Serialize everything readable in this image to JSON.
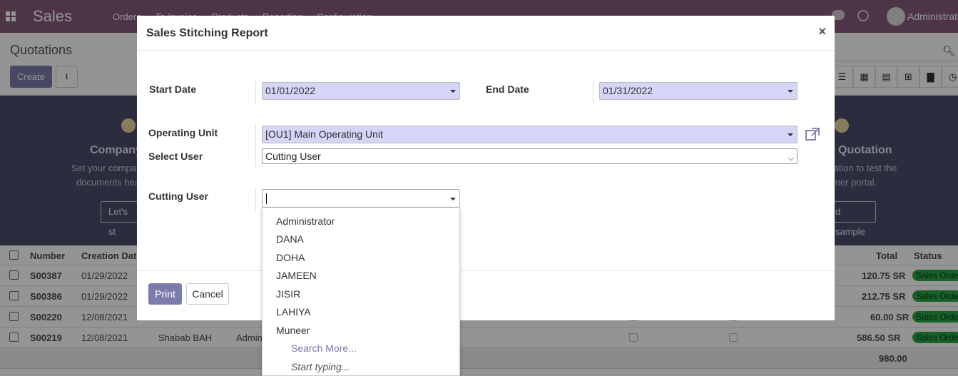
{
  "navbar": {
    "brand": "Sales",
    "menu": [
      "Orders",
      "To Invoice",
      "Products",
      "Reporting",
      "Configuration"
    ],
    "user": "Administrator"
  },
  "control_panel": {
    "title": "Quotations",
    "create_label": "Create"
  },
  "helper": {
    "left_heading": "Company",
    "left_text_1": "Set your compa",
    "left_text_2": "documents hea",
    "left_button": "Let's st",
    "right_heading": "Quotation",
    "right_text_1": "tation to test the",
    "right_text_2": "mer portal.",
    "right_button": "d sample"
  },
  "table": {
    "headers": {
      "number": "Number",
      "creation_date": "Creation Dat",
      "total": "Total",
      "status": "Status"
    },
    "rows": [
      {
        "number": "S00387",
        "date": "01/29/2022",
        "customer": "",
        "salesperson": "",
        "total": "120.75 SR",
        "status": "Sales Orde"
      },
      {
        "number": "S00386",
        "date": "01/29/2022",
        "customer": "",
        "salesperson": "",
        "total": "212.75 SR",
        "status": "Sales Orde"
      },
      {
        "number": "S00220",
        "date": "12/08/2021",
        "customer": "Shabab BAH",
        "salesperson": "Admin",
        "total": "60.00 SR",
        "status": "Sales Orde"
      },
      {
        "number": "S00219",
        "date": "12/08/2021",
        "customer": "Shabab BAH",
        "salesperson": "Admin",
        "total": "586.50 SR",
        "status": "Sales Orde"
      }
    ],
    "sum": "980.00"
  },
  "dialog": {
    "title": "Sales Stitching Report",
    "start_date_label": "Start Date",
    "start_date_value": "01/01/2022",
    "end_date_label": "End Date",
    "end_date_value": "01/31/2022",
    "operating_unit_label": "Operating Unit",
    "operating_unit_value": "[OU1] Main Operating Unit",
    "select_user_label": "Select User",
    "select_user_value": "Cutting User",
    "cutting_user_label": "Cutting User",
    "cutting_user_value": "",
    "print_label": "Print",
    "cancel_label": "Cancel"
  },
  "dropdown": {
    "items": [
      "Administrator",
      "DANA",
      "DOHA",
      "JAMEEN",
      "JISIR",
      "LAHIYA",
      "Muneer"
    ],
    "search_more": "Search More...",
    "start_typing": "Start typing..."
  },
  "colors": {
    "brand": "#875A7B",
    "accent": "#7C7BAD",
    "field_required": "#D5D5F8",
    "status_badge": "#28A745"
  }
}
